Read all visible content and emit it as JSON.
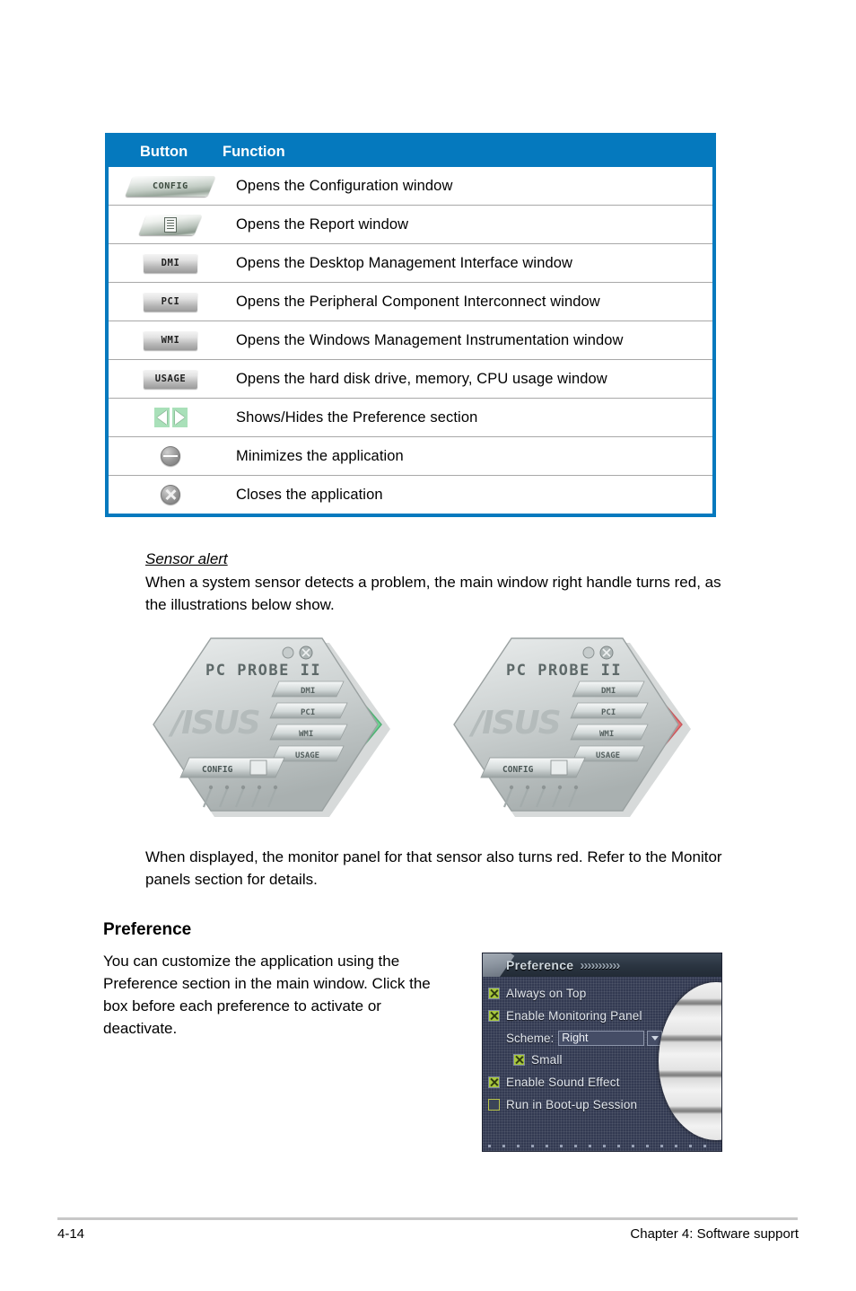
{
  "table": {
    "headers": {
      "button": "Button",
      "function": "Function"
    },
    "rows": [
      {
        "icon": "config-button-icon",
        "icon_label": "CONFIG",
        "style": "parallelogram-text",
        "function": "Opens the Configuration window"
      },
      {
        "icon": "report-button-icon",
        "icon_label": "",
        "style": "parallelogram-doc",
        "function": "Opens the Report window"
      },
      {
        "icon": "dmi-button-icon",
        "icon_label": "DMI",
        "style": "flat",
        "function": "Opens the Desktop Management Interface window"
      },
      {
        "icon": "pci-button-icon",
        "icon_label": "PCI",
        "style": "flat",
        "function": "Opens the Peripheral Component Interconnect window"
      },
      {
        "icon": "wmi-button-icon",
        "icon_label": "WMI",
        "style": "flat",
        "function": "Opens the Windows Management Instrumentation window"
      },
      {
        "icon": "usage-button-icon",
        "icon_label": "USAGE",
        "style": "flat",
        "function": "Opens the hard disk drive, memory, CPU usage window"
      },
      {
        "icon": "show-hide-arrows-icon",
        "icon_label": "",
        "style": "arrows",
        "function": "Shows/Hides the Preference section"
      },
      {
        "icon": "minimize-icon",
        "icon_label": "",
        "style": "minimize",
        "function": "Minimizes the application"
      },
      {
        "icon": "close-icon",
        "icon_label": "",
        "style": "close",
        "function": "Closes the application"
      }
    ]
  },
  "sensor_alert": {
    "heading": "Sensor alert",
    "body": "When a system sensor detects a problem, the main window right handle turns red, as the illustrations below show."
  },
  "illustrations": {
    "app_title": "PC PROBE II",
    "buttons": [
      "DMI",
      "PCI",
      "WMI",
      "USAGE"
    ],
    "config_label": "CONFIG",
    "brand": "ASUS",
    "left_handle_color": "#84e0a5",
    "right_handle_color": "#f08f91"
  },
  "monitor_note": "When displayed, the monitor panel for that sensor also turns red. Refer to the Monitor panels section for details.",
  "preference_section": {
    "heading": "Preference",
    "body": "You can customize the application using the Preference section in the main window. Click the box before each preference to activate or deactivate."
  },
  "preference_panel": {
    "title": "Preference",
    "chevrons": "›››››››››››",
    "items": [
      {
        "label": "Always on Top",
        "checked": true,
        "indent": 0
      },
      {
        "label": "Enable Monitoring Panel",
        "checked": true,
        "indent": 0
      },
      {
        "label": "Small",
        "checked": true,
        "indent": 2
      },
      {
        "label": "Enable Sound Effect",
        "checked": true,
        "indent": 0
      },
      {
        "label": "Run in Boot-up Session",
        "checked": false,
        "indent": 0
      }
    ],
    "scheme": {
      "label": "Scheme:",
      "value": "Right"
    }
  },
  "footer": {
    "page_number": "4-14",
    "chapter": "Chapter 4: Software support"
  },
  "colors": {
    "table_header_blue": "#0579BE",
    "row_divider": "#a8a8a8",
    "footer_rule": "#c8c8c8",
    "checkbox_green": "#a8c83c"
  }
}
